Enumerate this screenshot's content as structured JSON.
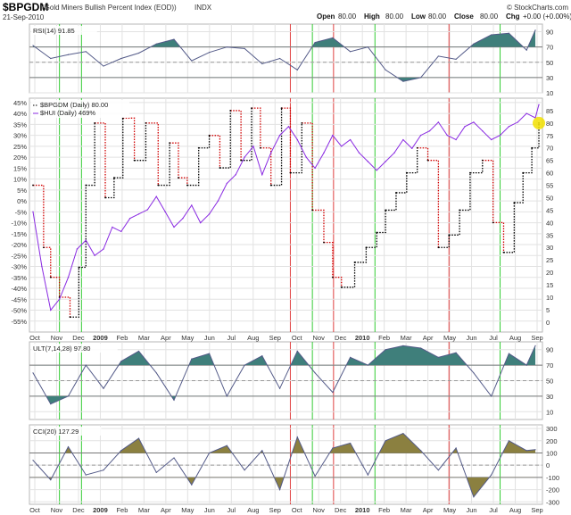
{
  "header": {
    "symbol": "$BPGDM",
    "name": "(Gold Miners Bullish Percent Index (EOD))",
    "exchange": "INDX",
    "date": "21-Sep-2010",
    "ohlc": [
      {
        "label": "Open",
        "value": "80.00"
      },
      {
        "label": "High",
        "value": "80.00"
      },
      {
        "label": "Low",
        "value": "80.00"
      },
      {
        "label": "Close",
        "value": "80.00"
      },
      {
        "label": "Chg",
        "value": "+0.00 (+0.00%)"
      }
    ],
    "watermark": "© StockCharts.com"
  },
  "colors": {
    "bg": "#ffffff",
    "panel_border": "#b7b7b7",
    "grid": "#e2e2e2",
    "fill_teal": "#3f7f7b",
    "fill_olive": "#8b8040",
    "line_grey": "#535a88",
    "bp_black": "#000000",
    "bp_red": "#d00000",
    "hui_purple": "#8a2be2",
    "vline_red": "#e04040",
    "vline_green": "#33cc33",
    "highlight": "#f2e000"
  },
  "chart_data": [
    {
      "panel": "rsi",
      "type": "line",
      "legend": "RSI(14) 91.85",
      "ylim": [
        10,
        100
      ],
      "yticks": [
        10,
        30,
        50,
        70,
        90
      ],
      "thresholds": [
        30,
        70
      ],
      "x": [
        0,
        20,
        40,
        60,
        80,
        100,
        120,
        140,
        160,
        180,
        200,
        220,
        240,
        260,
        280,
        300,
        320,
        340,
        360,
        380,
        400,
        420,
        440,
        460,
        480,
        500,
        520,
        540,
        560,
        570
      ],
      "values": [
        72,
        55,
        60,
        64,
        45,
        55,
        62,
        74,
        80,
        52,
        63,
        70,
        68,
        48,
        55,
        40,
        76,
        82,
        64,
        70,
        40,
        25,
        30,
        58,
        54,
        74,
        86,
        88,
        66,
        92
      ]
    },
    {
      "panel": "main",
      "type": "line",
      "legend": [
        "$BPGDM (Daily) 80.00",
        "$HUI (Daily) 469%"
      ],
      "left_axis": {
        "ylim": [
          -60,
          47
        ],
        "ticks": [
          -55,
          -50,
          -45,
          -40,
          -35,
          -30,
          -25,
          -20,
          -15,
          -10,
          -5,
          0,
          5,
          10,
          15,
          20,
          25,
          30,
          35,
          40,
          45
        ],
        "unit": "%"
      },
      "right_axis": {
        "ylim": [
          -4,
          90
        ],
        "ticks": [
          0,
          5,
          10,
          15,
          20,
          25,
          30,
          35,
          40,
          45,
          50,
          55,
          60,
          65,
          70,
          75,
          80,
          85
        ]
      },
      "x_labels": [
        "Oct",
        "Nov",
        "Dec",
        "2009",
        "Feb",
        "Mar",
        "Apr",
        "May",
        "Jun",
        "Jul",
        "Aug",
        "Sep",
        "Oct",
        "Nov",
        "Dec",
        "2010",
        "Feb",
        "Mar",
        "Apr",
        "May",
        "Jun",
        "Jul",
        "Aug",
        "Sep"
      ],
      "series": [
        {
          "name": "$BPGDM (Daily) 80.00",
          "axis": "right",
          "x": [
            0,
            12,
            20,
            30,
            42,
            52,
            60,
            70,
            82,
            92,
            102,
            115,
            128,
            142,
            155,
            165,
            175,
            188,
            200,
            212,
            224,
            236,
            248,
            258,
            270,
            282,
            292,
            305,
            317,
            330,
            340,
            350,
            365,
            378,
            390,
            400,
            412,
            424,
            436,
            448,
            460,
            472,
            484,
            496,
            510,
            522,
            534,
            546,
            556,
            566,
            574
          ],
          "values": [
            55,
            30,
            18,
            10,
            2,
            22,
            55,
            80,
            50,
            58,
            82,
            65,
            80,
            55,
            72,
            58,
            55,
            70,
            75,
            62,
            85,
            65,
            86,
            70,
            55,
            86,
            60,
            80,
            45,
            32,
            18,
            14,
            24,
            30,
            36,
            45,
            52,
            60,
            70,
            65,
            30,
            35,
            45,
            60,
            65,
            40,
            28,
            48,
            60,
            70,
            80
          ]
        },
        {
          "name": "$HUI (Daily) 469%",
          "axis": "left",
          "x": [
            0,
            10,
            20,
            30,
            40,
            50,
            60,
            70,
            80,
            90,
            100,
            110,
            120,
            130,
            140,
            150,
            160,
            170,
            180,
            190,
            200,
            210,
            220,
            230,
            240,
            250,
            260,
            270,
            280,
            290,
            300,
            310,
            320,
            330,
            340,
            350,
            360,
            370,
            380,
            390,
            400,
            410,
            420,
            430,
            440,
            450,
            460,
            470,
            480,
            490,
            500,
            510,
            520,
            530,
            540,
            550,
            560,
            570,
            574
          ],
          "values": [
            -5,
            -30,
            -50,
            -45,
            -35,
            -22,
            -18,
            -25,
            -22,
            -12,
            -14,
            -8,
            -6,
            -4,
            2,
            -5,
            -12,
            -8,
            -2,
            -10,
            -6,
            0,
            8,
            12,
            20,
            25,
            12,
            22,
            30,
            34,
            28,
            20,
            15,
            22,
            30,
            25,
            28,
            22,
            18,
            14,
            18,
            22,
            28,
            24,
            30,
            32,
            36,
            30,
            28,
            34,
            36,
            32,
            28,
            30,
            34,
            36,
            40,
            38,
            44
          ]
        }
      ]
    },
    {
      "panel": "ult",
      "type": "line",
      "legend": "ULT(7,14,28) 97.80",
      "ylim": [
        0,
        100
      ],
      "yticks": [
        10,
        30,
        50,
        70,
        90
      ],
      "thresholds": [
        30,
        70
      ],
      "x": [
        0,
        20,
        40,
        60,
        80,
        100,
        120,
        140,
        160,
        180,
        200,
        220,
        240,
        260,
        280,
        300,
        320,
        340,
        360,
        380,
        400,
        420,
        440,
        460,
        480,
        500,
        520,
        540,
        560,
        570
      ],
      "values": [
        60,
        20,
        30,
        70,
        40,
        75,
        88,
        60,
        25,
        78,
        85,
        30,
        70,
        82,
        40,
        88,
        60,
        35,
        80,
        70,
        90,
        95,
        92,
        80,
        86,
        60,
        30,
        85,
        70,
        95
      ]
    },
    {
      "panel": "cci",
      "type": "line",
      "legend": "CCI(20) 127.29",
      "ylim": [
        -320,
        330
      ],
      "yticks": [
        -300,
        -200,
        -100,
        0,
        100,
        200,
        300
      ],
      "thresholds": [
        -100,
        100
      ],
      "x": [
        0,
        20,
        40,
        60,
        80,
        100,
        120,
        140,
        160,
        180,
        200,
        220,
        240,
        260,
        280,
        300,
        320,
        340,
        360,
        380,
        400,
        420,
        440,
        460,
        480,
        500,
        520,
        540,
        560,
        570
      ],
      "values": [
        40,
        -120,
        150,
        -80,
        -40,
        120,
        220,
        -60,
        60,
        -160,
        100,
        160,
        -40,
        120,
        -200,
        230,
        -90,
        140,
        180,
        -80,
        200,
        260,
        120,
        -40,
        140,
        -260,
        -80,
        200,
        120,
        127
      ]
    }
  ],
  "time_axis": {
    "labels": [
      "Oct",
      "Nov",
      "Dec",
      "2009",
      "Feb",
      "Mar",
      "Apr",
      "May",
      "Jun",
      "Jul",
      "Aug",
      "Sep",
      "Oct",
      "Nov",
      "Dec",
      "2010",
      "Feb",
      "Mar",
      "Apr",
      "May",
      "Jun",
      "Jul",
      "Aug",
      "Sep"
    ],
    "bold_labels": [
      "2009",
      "2010"
    ],
    "red_markers": [
      292,
      341,
      472
    ],
    "green_markers": [
      30,
      55,
      317,
      388,
      530
    ]
  }
}
